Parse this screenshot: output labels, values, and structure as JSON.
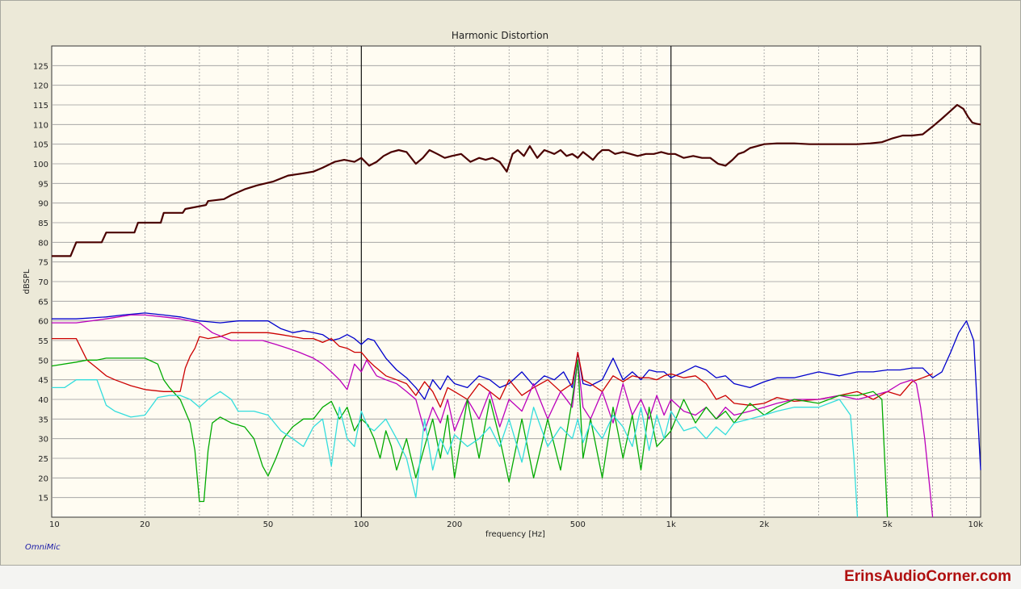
{
  "app_label": "OmniMic",
  "site_label": "ErinsAudioCorner.com",
  "chart_data": {
    "type": "line",
    "title": "Harmonic Distortion",
    "xlabel": "frequency [Hz]",
    "ylabel": "dBSPL",
    "xscale": "log",
    "xlim": [
      10,
      10000
    ],
    "ylim": [
      10,
      130
    ],
    "grid": true,
    "x_ticks": [
      10,
      20,
      50,
      100,
      200,
      500,
      1000,
      2000,
      5000,
      10000
    ],
    "x_tick_labels": [
      "10",
      "20",
      "50",
      "100",
      "200",
      "500",
      "1k",
      "2k",
      "5k",
      "10k"
    ],
    "y_ticks": [
      15,
      20,
      25,
      30,
      35,
      40,
      45,
      50,
      55,
      60,
      65,
      70,
      75,
      80,
      85,
      90,
      95,
      100,
      105,
      110,
      115,
      120,
      125
    ],
    "y_tick_labels": [
      "15",
      "20",
      "25",
      "30",
      "35",
      "40",
      "45",
      "50",
      "55",
      "60",
      "65",
      "70",
      "75",
      "80",
      "85",
      "90",
      "95",
      "100",
      "105",
      "110",
      "115",
      "120",
      "125"
    ],
    "colors": {
      "plot_bg": "#fffcf2",
      "grid": "#9a9a9a",
      "decade": "#111111"
    },
    "series": [
      {
        "color": "#4a0000",
        "width": 2.2,
        "x": [
          10,
          11.5,
          12,
          14.5,
          15,
          18.5,
          19,
          22.5,
          23,
          26.5,
          27,
          31.5,
          32,
          36,
          38,
          42,
          46,
          52,
          58,
          64,
          70,
          75,
          82,
          88,
          95,
          100,
          106,
          112,
          118,
          125,
          132,
          140,
          150,
          158,
          166,
          176,
          186,
          196,
          210,
          225,
          240,
          252,
          265,
          280,
          295,
          308,
          320,
          335,
          350,
          370,
          390,
          405,
          420,
          440,
          460,
          480,
          500,
          520,
          540,
          560,
          580,
          600,
          630,
          660,
          700,
          740,
          780,
          830,
          880,
          930,
          980,
          1030,
          1100,
          1180,
          1260,
          1340,
          1420,
          1500,
          1580,
          1650,
          1720,
          1800,
          1900,
          2000,
          2200,
          2500,
          2800,
          3200,
          3600,
          4000,
          4400,
          4800,
          5200,
          5600,
          6000,
          6500,
          7000,
          7500,
          8000,
          8400,
          8800,
          9100,
          9400,
          9700,
          10000
        ],
        "y": [
          76.5,
          76.5,
          80,
          80,
          82.5,
          82.5,
          85,
          85,
          87.5,
          87.5,
          88.5,
          89.5,
          90.5,
          91,
          92,
          93.5,
          94.5,
          95.5,
          97,
          97.5,
          98,
          99,
          100.5,
          101,
          100.5,
          101.5,
          99.5,
          100.5,
          102,
          103,
          103.5,
          103,
          100,
          101.5,
          103.5,
          102.5,
          101.5,
          102,
          102.5,
          100.5,
          101.5,
          101,
          101.5,
          100.5,
          98,
          102.5,
          103.5,
          102,
          104.5,
          101.5,
          103.5,
          103,
          102.5,
          103.5,
          102,
          102.5,
          101.5,
          103,
          102,
          101,
          102.5,
          103.5,
          103.5,
          102.5,
          103,
          102.5,
          102,
          102.5,
          102.5,
          103,
          102.5,
          102.5,
          101.5,
          102,
          101.5,
          101.5,
          100,
          99.5,
          101,
          102.5,
          103,
          104,
          104.5,
          105,
          105.2,
          105.2,
          105,
          105,
          105,
          105,
          105.2,
          105.5,
          106.5,
          107.2,
          107.2,
          107.5,
          109.5,
          111.5,
          113.5,
          115,
          114,
          112,
          110.5,
          110.2,
          110
        ]
      },
      {
        "color": "#0000cc",
        "width": 1.3,
        "x": [
          10,
          12,
          15,
          17,
          20,
          23,
          26,
          30,
          35,
          40,
          45,
          50,
          55,
          60,
          65,
          70,
          75,
          80,
          85,
          90,
          95,
          100,
          105,
          110,
          120,
          130,
          140,
          150,
          160,
          170,
          180,
          190,
          200,
          220,
          240,
          260,
          280,
          300,
          330,
          360,
          390,
          420,
          450,
          480,
          500,
          520,
          550,
          600,
          650,
          700,
          750,
          800,
          850,
          900,
          950,
          1000,
          1100,
          1200,
          1300,
          1400,
          1500,
          1600,
          1800,
          2000,
          2200,
          2500,
          3000,
          3500,
          4000,
          4500,
          5000,
          5500,
          6000,
          6500,
          7000,
          7500,
          8000,
          8500,
          9000,
          9500,
          10000
        ],
        "y": [
          60.5,
          60.5,
          61,
          61.5,
          62,
          61.5,
          61,
          60,
          59.5,
          60,
          60,
          60,
          58,
          57,
          57.5,
          57,
          56.5,
          55,
          55.5,
          56.5,
          55.5,
          54,
          55.5,
          55,
          50.5,
          47.5,
          45.5,
          43,
          40,
          45,
          42.5,
          46,
          44,
          43,
          46,
          45,
          43,
          44,
          47,
          43.5,
          46,
          45,
          47,
          43,
          52,
          44,
          43.5,
          45,
          50.5,
          45,
          47,
          45,
          47.5,
          47,
          47,
          45.5,
          47,
          48.5,
          47.5,
          45.5,
          46,
          44,
          43,
          44.5,
          45.5,
          45.5,
          47,
          46,
          47,
          47,
          47.5,
          47.5,
          48,
          48,
          45.5,
          47,
          52,
          57,
          60,
          55,
          22
        ]
      },
      {
        "color": "#cc0000",
        "width": 1.3,
        "x": [
          10,
          12,
          13,
          14,
          15,
          16,
          18,
          20,
          23,
          26,
          27,
          28,
          29,
          30,
          32,
          35,
          38,
          40,
          45,
          50,
          55,
          60,
          65,
          70,
          75,
          80,
          85,
          90,
          95,
          100,
          105,
          110,
          120,
          130,
          140,
          150,
          160,
          170,
          180,
          190,
          200,
          220,
          240,
          260,
          280,
          300,
          330,
          360,
          400,
          440,
          480,
          500,
          520,
          550,
          600,
          650,
          700,
          750,
          800,
          850,
          900,
          950,
          1000,
          1100,
          1200,
          1300,
          1400,
          1500,
          1600,
          1800,
          2000,
          2200,
          2500,
          3000,
          3500,
          4000,
          4500,
          5000,
          5500,
          6000,
          6500,
          7000
        ],
        "y": [
          55.5,
          55.5,
          50,
          48,
          46,
          45,
          43.5,
          42.5,
          42,
          42,
          48,
          51,
          53,
          56,
          55.5,
          56,
          57,
          57,
          57,
          57,
          56.5,
          56,
          55.5,
          55.5,
          54.5,
          55.5,
          53.5,
          53,
          52,
          52,
          50,
          48.5,
          46,
          45,
          44,
          41,
          44.5,
          42,
          38,
          43,
          42,
          40,
          44,
          42,
          40,
          45,
          41,
          43,
          45,
          42,
          44,
          52,
          45,
          44,
          42,
          46,
          44.5,
          46,
          45.5,
          45.5,
          45,
          46,
          46.5,
          45.5,
          46,
          44,
          40,
          41,
          39,
          38.5,
          39,
          40.5,
          39.5,
          40,
          41,
          42,
          40,
          42,
          41,
          44.5,
          45.5,
          46.5
        ]
      },
      {
        "color": "#bb00bb",
        "width": 1.3,
        "x": [
          10,
          12,
          15,
          18,
          20,
          23,
          26,
          30,
          33,
          38,
          43,
          48,
          53,
          58,
          63,
          70,
          75,
          80,
          85,
          90,
          95,
          100,
          104,
          108,
          112,
          120,
          130,
          140,
          150,
          160,
          170,
          180,
          190,
          200,
          220,
          240,
          260,
          280,
          300,
          330,
          360,
          400,
          440,
          480,
          500,
          520,
          550,
          600,
          650,
          700,
          750,
          800,
          850,
          900,
          950,
          1000,
          1100,
          1200,
          1300,
          1400,
          1500,
          1600,
          1800,
          2000,
          2200,
          2500,
          3000,
          3500,
          4000,
          4500,
          5000,
          5500,
          6000,
          6200,
          6400,
          6600,
          6800,
          7000
        ],
        "y": [
          59.5,
          59.5,
          60.5,
          61.5,
          61.5,
          61,
          60.5,
          59.5,
          57,
          55,
          55,
          55,
          54,
          53,
          52,
          50.5,
          49,
          47,
          45,
          42.5,
          49,
          47,
          50,
          48,
          46,
          45,
          44,
          42,
          40,
          32,
          38,
          34,
          40,
          32,
          40,
          35,
          42,
          33,
          40,
          37,
          44,
          35,
          42,
          38,
          50,
          38,
          35,
          42,
          34,
          44,
          36,
          40,
          35,
          41,
          36,
          40,
          37,
          36,
          38,
          35,
          38,
          36,
          37,
          38,
          39,
          40,
          40,
          41,
          40,
          41,
          42,
          44,
          45,
          44,
          38,
          30,
          20,
          10
        ]
      },
      {
        "color": "#00aa00",
        "width": 1.3,
        "x": [
          10,
          12,
          13,
          14,
          15,
          16,
          18,
          20,
          22,
          23,
          24,
          26,
          28,
          29,
          30,
          31,
          32,
          33,
          35,
          38,
          42,
          45,
          48,
          50,
          53,
          56,
          60,
          65,
          70,
          75,
          80,
          85,
          90,
          95,
          100,
          105,
          110,
          115,
          120,
          125,
          130,
          140,
          150,
          160,
          170,
          180,
          190,
          200,
          220,
          240,
          260,
          280,
          300,
          330,
          360,
          400,
          440,
          480,
          500,
          520,
          550,
          600,
          650,
          700,
          750,
          800,
          850,
          900,
          950,
          1000,
          1100,
          1200,
          1300,
          1400,
          1500,
          1600,
          1800,
          2000,
          2200,
          2500,
          3000,
          3500,
          4000,
          4500,
          4800,
          4900,
          5000
        ],
        "y": [
          48.5,
          49.5,
          50,
          50,
          50.5,
          50.5,
          50.5,
          50.5,
          49,
          45,
          43,
          40,
          34,
          27,
          14,
          14,
          27,
          34,
          35.5,
          34,
          33,
          30,
          23,
          20.5,
          25,
          30,
          33,
          35,
          35,
          38,
          39.5,
          35,
          38,
          32,
          35,
          33.5,
          30,
          25,
          32,
          28,
          22,
          30,
          20,
          28,
          35,
          25,
          36,
          20,
          40,
          25,
          40,
          30,
          19,
          35,
          20,
          35,
          22,
          40,
          50,
          25,
          35,
          20,
          38,
          25,
          36,
          22,
          38,
          28,
          30,
          32,
          40,
          34,
          38,
          35,
          37,
          34,
          39,
          36,
          38,
          40,
          39,
          41,
          41,
          42,
          40,
          25,
          10
        ]
      },
      {
        "color": "#33dddd",
        "width": 1.3,
        "x": [
          10,
          11,
          12,
          13,
          14,
          15,
          16,
          18,
          20,
          22,
          24,
          26,
          28,
          30,
          32,
          35,
          38,
          40,
          45,
          50,
          55,
          60,
          65,
          70,
          75,
          80,
          85,
          90,
          95,
          100,
          105,
          110,
          120,
          130,
          140,
          150,
          160,
          170,
          180,
          190,
          200,
          220,
          240,
          260,
          280,
          300,
          330,
          360,
          400,
          440,
          480,
          500,
          520,
          550,
          600,
          650,
          700,
          750,
          800,
          850,
          900,
          950,
          1000,
          1100,
          1200,
          1300,
          1400,
          1500,
          1600,
          1800,
          2000,
          2200,
          2500,
          3000,
          3500,
          3800,
          3900,
          4000
        ],
        "y": [
          43,
          43,
          45,
          45,
          45,
          38.5,
          37,
          35.5,
          36,
          40.5,
          41,
          41,
          40,
          38,
          40,
          42,
          40,
          37,
          37,
          36,
          32,
          30,
          28,
          33,
          35,
          23,
          38,
          30,
          28,
          37,
          33,
          32,
          35,
          30,
          25,
          15,
          35,
          22,
          30,
          26,
          31,
          28,
          30,
          33,
          28,
          35,
          24,
          38,
          28,
          33,
          30,
          35,
          29,
          34,
          30,
          36,
          33,
          28,
          38,
          27,
          36,
          30,
          37,
          32,
          33,
          30,
          33,
          31,
          34,
          35,
          36,
          37,
          38,
          38,
          40,
          36,
          25,
          10
        ]
      }
    ]
  }
}
